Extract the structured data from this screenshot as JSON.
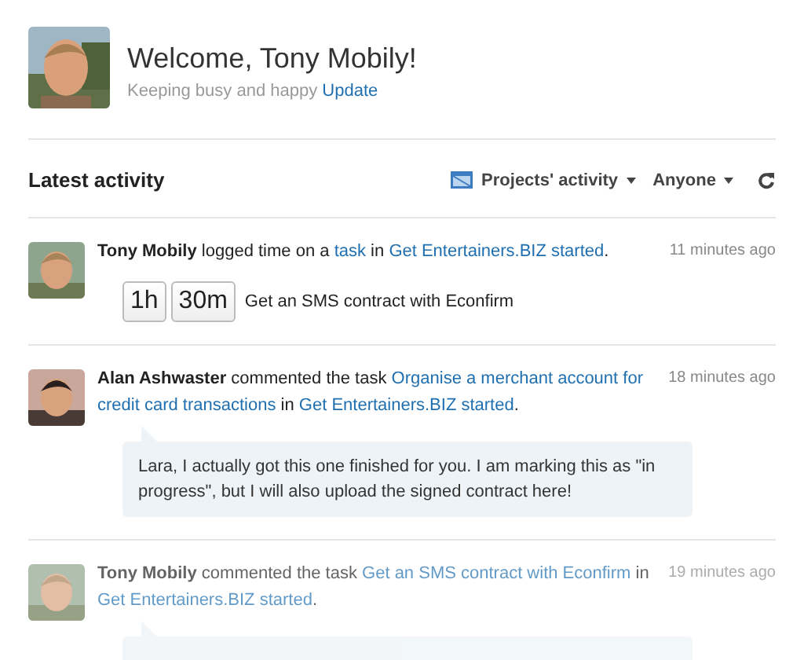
{
  "header": {
    "title": "Welcome, Tony Mobily!",
    "status": "Keeping busy and happy",
    "status_link": "Update"
  },
  "activity": {
    "title": "Latest activity",
    "filter": "Projects' activity",
    "person_filter": "Anyone",
    "items": [
      {
        "author": "Tony Mobily",
        "parts": [
          {
            "kind": "text",
            "text": " logged time on a "
          },
          {
            "kind": "link",
            "text": "task"
          },
          {
            "kind": "text",
            "text": " in "
          },
          {
            "kind": "link",
            "text": "Get Entertainers.BIZ started"
          },
          {
            "kind": "text",
            "text": "."
          }
        ],
        "time": "11 minutes ago",
        "detail": {
          "kind": "timelog",
          "hours": "1h",
          "minutes": "30m",
          "task": "Get an SMS contract with Econfirm"
        },
        "faded": false
      },
      {
        "author": "Alan Ashwaster",
        "parts": [
          {
            "kind": "text",
            "text": " commented the task "
          },
          {
            "kind": "link",
            "lines": [
              "Organise a merchant account for",
              "credit card transactions"
            ]
          },
          {
            "kind": "text",
            "text": " in "
          },
          {
            "kind": "link",
            "text": "Get Entertainers.BIZ started"
          },
          {
            "kind": "text",
            "text": "."
          }
        ],
        "time": "18 minutes ago",
        "detail": {
          "kind": "comment",
          "text": "Lara, I actually got this one finished for you. I am marking this as \"in progress\", but I will also upload the signed contract here!"
        },
        "faded": false
      },
      {
        "author": "Tony Mobily",
        "parts": [
          {
            "kind": "text",
            "text": " commented the task "
          },
          {
            "kind": "link",
            "text": "Get an SMS contract with Econfirm"
          },
          {
            "kind": "text",
            "text": " in "
          },
          {
            "kind": "link",
            "text": "Get Entertainers.BIZ started"
          },
          {
            "kind": "text",
            "text": "."
          }
        ],
        "time": "19 minutes ago",
        "detail": {
          "kind": "comment"
        },
        "faded": true
      }
    ]
  }
}
